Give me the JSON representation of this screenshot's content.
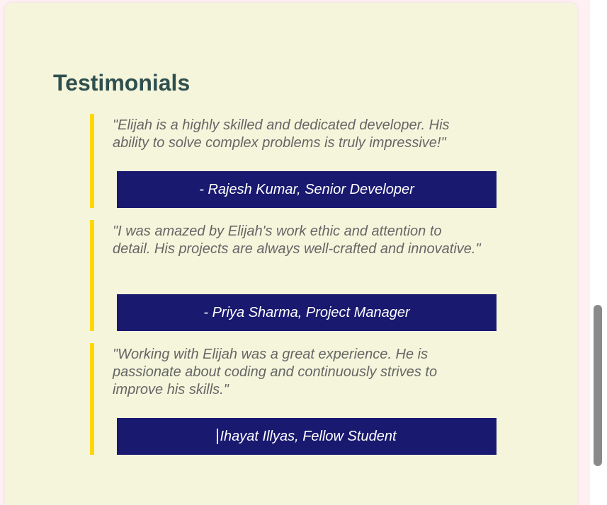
{
  "section": {
    "title": "Testimonials"
  },
  "testimonials": [
    {
      "quote": "\"Elijah is a highly skilled and dedicated developer. His ability to solve complex problems is truly impressive!\"",
      "author": "- Rajesh Kumar, Senior Developer"
    },
    {
      "quote": "\"I was amazed by Elijah's work ethic and attention to detail. His projects are always well-crafted and innovative.\"",
      "author": "- Priya Sharma, Project Manager"
    },
    {
      "quote": "\"Working with Elijah was a great experience. He is passionate about coding and continuously strives to improve his skills.\"",
      "author": "Ihayat Illyas, Fellow Student"
    }
  ],
  "colors": {
    "page_background": "#fff0f3",
    "card_background": "#f5f5dc",
    "accent_border": "#ffd700",
    "author_background": "#191970",
    "title_color": "#2f4f4f",
    "quote_color": "#666666"
  },
  "icons": {
    "text_cursor": "text-cursor-icon"
  }
}
